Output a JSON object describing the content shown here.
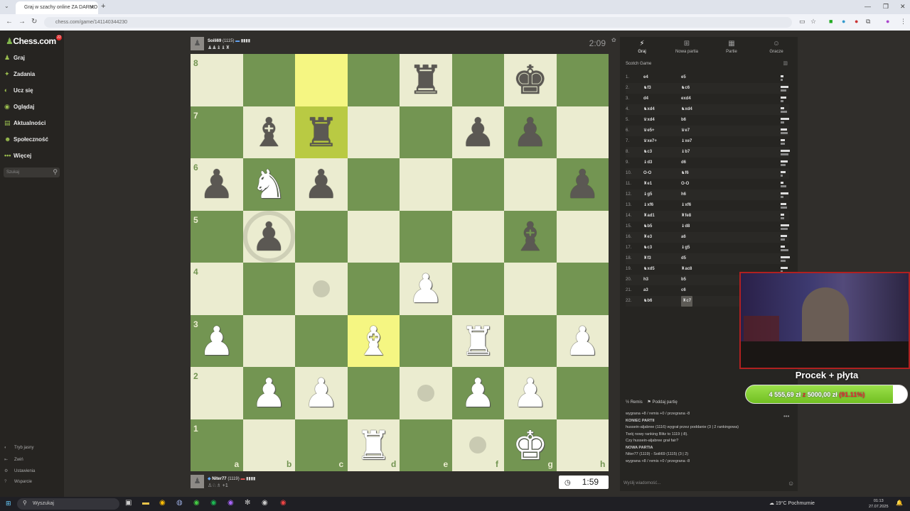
{
  "browser": {
    "tab_title": "Graj w szachy online ZA DARMO",
    "url": "chess.com/game/141140344230"
  },
  "sidebar": {
    "logo": "Chess.com",
    "notif_count": "22",
    "items": [
      {
        "label": "Graj",
        "icon": "pawn-icon"
      },
      {
        "label": "Zadania",
        "icon": "puzzle-icon"
      },
      {
        "label": "Ucz się",
        "icon": "learn-icon"
      },
      {
        "label": "Oglądaj",
        "icon": "watch-icon"
      },
      {
        "label": "Aktualności",
        "icon": "news-icon"
      },
      {
        "label": "Społeczność",
        "icon": "community-icon"
      },
      {
        "label": "Więcej",
        "icon": "more-icon"
      }
    ],
    "search_placeholder": "Szukaj",
    "footer": [
      "Tryb jasny",
      "Zwiń",
      "Ustawienia",
      "Wsparcie"
    ]
  },
  "top_player": {
    "name": "Soili69",
    "rating": "(1115)",
    "captured": "♟♟♝♝♜",
    "clock": "2:09"
  },
  "bottom_player": {
    "name": "Niter77",
    "rating": "(1119)",
    "captured": "+1",
    "clock": "1:59"
  },
  "board": {
    "files": [
      "a",
      "b",
      "c",
      "d",
      "e",
      "f",
      "g",
      "h"
    ],
    "ranks": [
      "8",
      "7",
      "6",
      "5",
      "4",
      "3",
      "2",
      "1"
    ],
    "highlights": [
      "c8",
      "c7",
      "d3"
    ],
    "dots": [
      "c4",
      "e2",
      "f1"
    ],
    "rings": [
      "b5"
    ],
    "pieces": [
      {
        "sq": "e8",
        "p": "♜",
        "c": "b"
      },
      {
        "sq": "g8",
        "p": "♚",
        "c": "b"
      },
      {
        "sq": "b7",
        "p": "♝",
        "c": "b"
      },
      {
        "sq": "c7",
        "p": "♜",
        "c": "b"
      },
      {
        "sq": "f7",
        "p": "♟",
        "c": "b"
      },
      {
        "sq": "g7",
        "p": "♟",
        "c": "b"
      },
      {
        "sq": "a6",
        "p": "♟",
        "c": "b"
      },
      {
        "sq": "b6",
        "p": "♞",
        "c": "w"
      },
      {
        "sq": "c6",
        "p": "♟",
        "c": "b"
      },
      {
        "sq": "h6",
        "p": "♟",
        "c": "b"
      },
      {
        "sq": "b5",
        "p": "♟",
        "c": "b"
      },
      {
        "sq": "g5",
        "p": "♝",
        "c": "b"
      },
      {
        "sq": "e4",
        "p": "♟",
        "c": "w"
      },
      {
        "sq": "a3",
        "p": "♟",
        "c": "w"
      },
      {
        "sq": "d3",
        "p": "♝",
        "c": "w"
      },
      {
        "sq": "f3",
        "p": "♜",
        "c": "w"
      },
      {
        "sq": "h3",
        "p": "♟",
        "c": "w"
      },
      {
        "sq": "b2",
        "p": "♟",
        "c": "w"
      },
      {
        "sq": "c2",
        "p": "♟",
        "c": "w"
      },
      {
        "sq": "f2",
        "p": "♟",
        "c": "w"
      },
      {
        "sq": "g2",
        "p": "♟",
        "c": "w"
      },
      {
        "sq": "d1",
        "p": "♜",
        "c": "w"
      },
      {
        "sq": "g1",
        "p": "♚",
        "c": "w"
      }
    ]
  },
  "panel": {
    "tabs": [
      {
        "label": "Graj",
        "icon": "bolt-icon"
      },
      {
        "label": "Nowa partia",
        "icon": "plus-icon"
      },
      {
        "label": "Partie",
        "icon": "games-icon"
      },
      {
        "label": "Gracze",
        "icon": "players-icon"
      }
    ],
    "opening": "Scotch Game",
    "moves": [
      {
        "n": "1.",
        "w": "e4",
        "b": "e5"
      },
      {
        "n": "2.",
        "w": "♞f3",
        "b": "♞c6"
      },
      {
        "n": "3.",
        "w": "d4",
        "b": "exd4"
      },
      {
        "n": "4.",
        "w": "♞xd4",
        "b": "♞xd4"
      },
      {
        "n": "5.",
        "w": "♛xd4",
        "b": "b6"
      },
      {
        "n": "6.",
        "w": "♛e5+",
        "b": "♛e7"
      },
      {
        "n": "7.",
        "w": "♛xe7+",
        "b": "♝xe7"
      },
      {
        "n": "8.",
        "w": "♞c3",
        "b": "♝b7"
      },
      {
        "n": "9.",
        "w": "♝d3",
        "b": "d6"
      },
      {
        "n": "10.",
        "w": "O-O",
        "b": "♞f6"
      },
      {
        "n": "11.",
        "w": "♜e1",
        "b": "O-O"
      },
      {
        "n": "12.",
        "w": "♝g5",
        "b": "h6"
      },
      {
        "n": "13.",
        "w": "♝xf6",
        "b": "♝xf6"
      },
      {
        "n": "14.",
        "w": "♜ad1",
        "b": "♜fe8"
      },
      {
        "n": "15.",
        "w": "♞b5",
        "b": "♝d8"
      },
      {
        "n": "16.",
        "w": "♜e3",
        "b": "a6"
      },
      {
        "n": "17.",
        "w": "♞c3",
        "b": "♝g5"
      },
      {
        "n": "18.",
        "w": "♜f3",
        "b": "d5"
      },
      {
        "n": "19.",
        "w": "♞xd5",
        "b": "♜ac8"
      },
      {
        "n": "20.",
        "w": "h3",
        "b": "b5"
      },
      {
        "n": "21.",
        "w": "a3",
        "b": "c6"
      },
      {
        "n": "22.",
        "w": "♞b6",
        "b": "♜c7"
      }
    ],
    "draw_label": "Remis",
    "resign_label": "Poddaj partię",
    "chat_lines": [
      {
        "t": "wygrana +8 / remis +0 / przegrana -8",
        "bold": false
      },
      {
        "t": "KONIEC PARTII",
        "bold": true
      },
      {
        "t": "hussein-aljabree (1116) wygrał przez poddanie (3 | 2 rankingowa)",
        "bold": false
      },
      {
        "t": "Twój nowy ranking Blitz to 1119 (-8).",
        "bold": false
      },
      {
        "t": "Czy hussein-aljabree grał fair?",
        "bold": false
      },
      {
        "t": "NOWA PARTIA",
        "bold": true
      },
      {
        "t": "Niter77 (1119) - Soili69 (1115) (3 | 2)",
        "bold": false
      },
      {
        "t": "wygrana +8 / remis +0 / przegrana -8",
        "bold": false
      }
    ],
    "chat_placeholder": "Wyślij wiadomość..."
  },
  "stream": {
    "goal_title": "Procek + płyta",
    "goal_current": "4 555,69 zł",
    "goal_sep": "z",
    "goal_target": "5000,00 zł",
    "goal_percent": "(91.11%)",
    "goal_fraction": 0.9111
  },
  "taskbar": {
    "search": "Wyszukaj",
    "weather": "19°C  Pochmurnie",
    "time": "01:13",
    "date": "27.07.2025"
  }
}
